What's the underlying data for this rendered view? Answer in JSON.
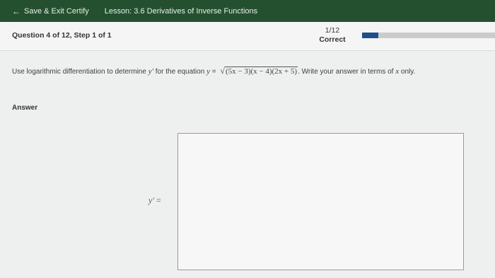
{
  "topbar": {
    "back_label": "Save & Exit Certify",
    "back_arrow": "←",
    "lesson": "Lesson: 3.6 Derivatives of Inverse Functions"
  },
  "question": {
    "title": "Question 4 of 12, Step 1 of 1",
    "score": "1/12",
    "status": "Correct",
    "progress_fraction": 0.12
  },
  "prompt": {
    "pre": "Use logarithmic differentiation to determine ",
    "var": "y′",
    "mid": " for the equation ",
    "lhs": "y",
    "equals": " = ",
    "radical": "√",
    "radicand": "(5x − 3)(x − 4)(2x + 5)",
    "post": ". Write your answer in terms of ",
    "xvar": "x",
    "end": " only."
  },
  "answer": {
    "label": "Answer",
    "lhs": "y′",
    "equals": "="
  },
  "colors": {
    "header": "#24502f",
    "progress": "#1e4f8c",
    "background": "#eef0ef"
  }
}
